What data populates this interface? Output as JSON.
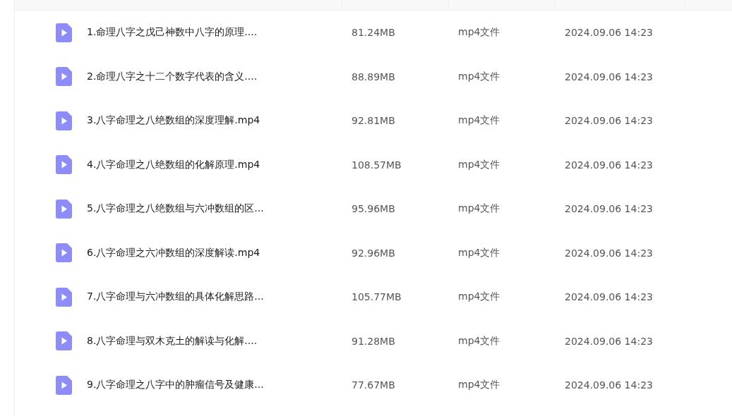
{
  "files": [
    {
      "name": "1.命理八字之戊己神数中八字的原理....",
      "size": "81.24MB",
      "type": "mp4文件",
      "modified": "2024.09.06 14:23"
    },
    {
      "name": "2.命理八字之十二个数字代表的含义....",
      "size": "88.89MB",
      "type": "mp4文件",
      "modified": "2024.09.06 14:23"
    },
    {
      "name": "3.八字命理之八绝数组的深度理解.mp4",
      "size": "92.81MB",
      "type": "mp4文件",
      "modified": "2024.09.06 14:23"
    },
    {
      "name": "4.八字命理之八绝数组的化解原理.mp4",
      "size": "108.57MB",
      "type": "mp4文件",
      "modified": "2024.09.06 14:23"
    },
    {
      "name": "5.八字命理之八绝数组与六冲数组的区...",
      "size": "95.96MB",
      "type": "mp4文件",
      "modified": "2024.09.06 14:23"
    },
    {
      "name": "6.八字命理之六冲数组的深度解读.mp4",
      "size": "92.96MB",
      "type": "mp4文件",
      "modified": "2024.09.06 14:23"
    },
    {
      "name": "7.八字命理与六冲数组的具体化解思路...",
      "size": "105.77MB",
      "type": "mp4文件",
      "modified": "2024.09.06 14:23"
    },
    {
      "name": "8.八字命理与双木克土的解读与化解....",
      "size": "91.28MB",
      "type": "mp4文件",
      "modified": "2024.09.06 14:23"
    },
    {
      "name": "9.八字命理之八字中的肿瘤信号及健康...",
      "size": "77.67MB",
      "type": "mp4文件",
      "modified": "2024.09.06 14:23"
    }
  ]
}
